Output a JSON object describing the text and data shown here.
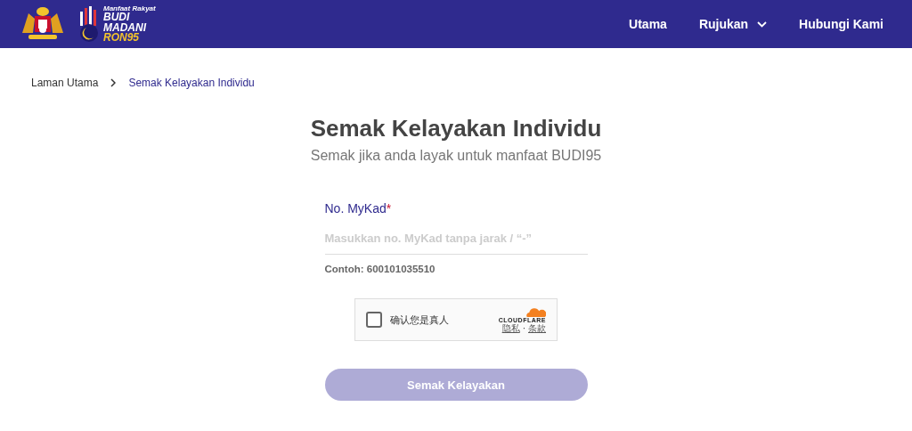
{
  "header": {
    "logo": {
      "tagline": "Manfaat Rakyat",
      "line_1": "BUDI",
      "line_2": "MADANI",
      "line_3": "RON95"
    },
    "nav": [
      {
        "label": "Utama",
        "kind": "link"
      },
      {
        "label": "Rujukan",
        "kind": "dropdown"
      },
      {
        "label": "Hubungi Kami",
        "kind": "link"
      }
    ]
  },
  "breadcrumb": [
    {
      "label": "Laman Utama",
      "selected": false
    },
    {
      "label": "Semak Kelayakan Individu",
      "selected": true
    }
  ],
  "title": "Semak Kelayakan Individu",
  "subtitle": "Semak jika anda layak untuk manfaat BUDI95",
  "form": {
    "label": "No. MyKad",
    "required_mark": "*",
    "placeholder": "Masukkan no. MyKad tanpa jarak / “-”",
    "hint": "Contoh: 600101035510",
    "captcha": {
      "checked": false,
      "label": "确认您是真人",
      "brand": "CLOUDFLARE",
      "privacy": "隐私",
      "separator": "·",
      "terms": "条款"
    },
    "submit": {
      "label": "Semak Kelayakan",
      "disabled": true
    }
  }
}
